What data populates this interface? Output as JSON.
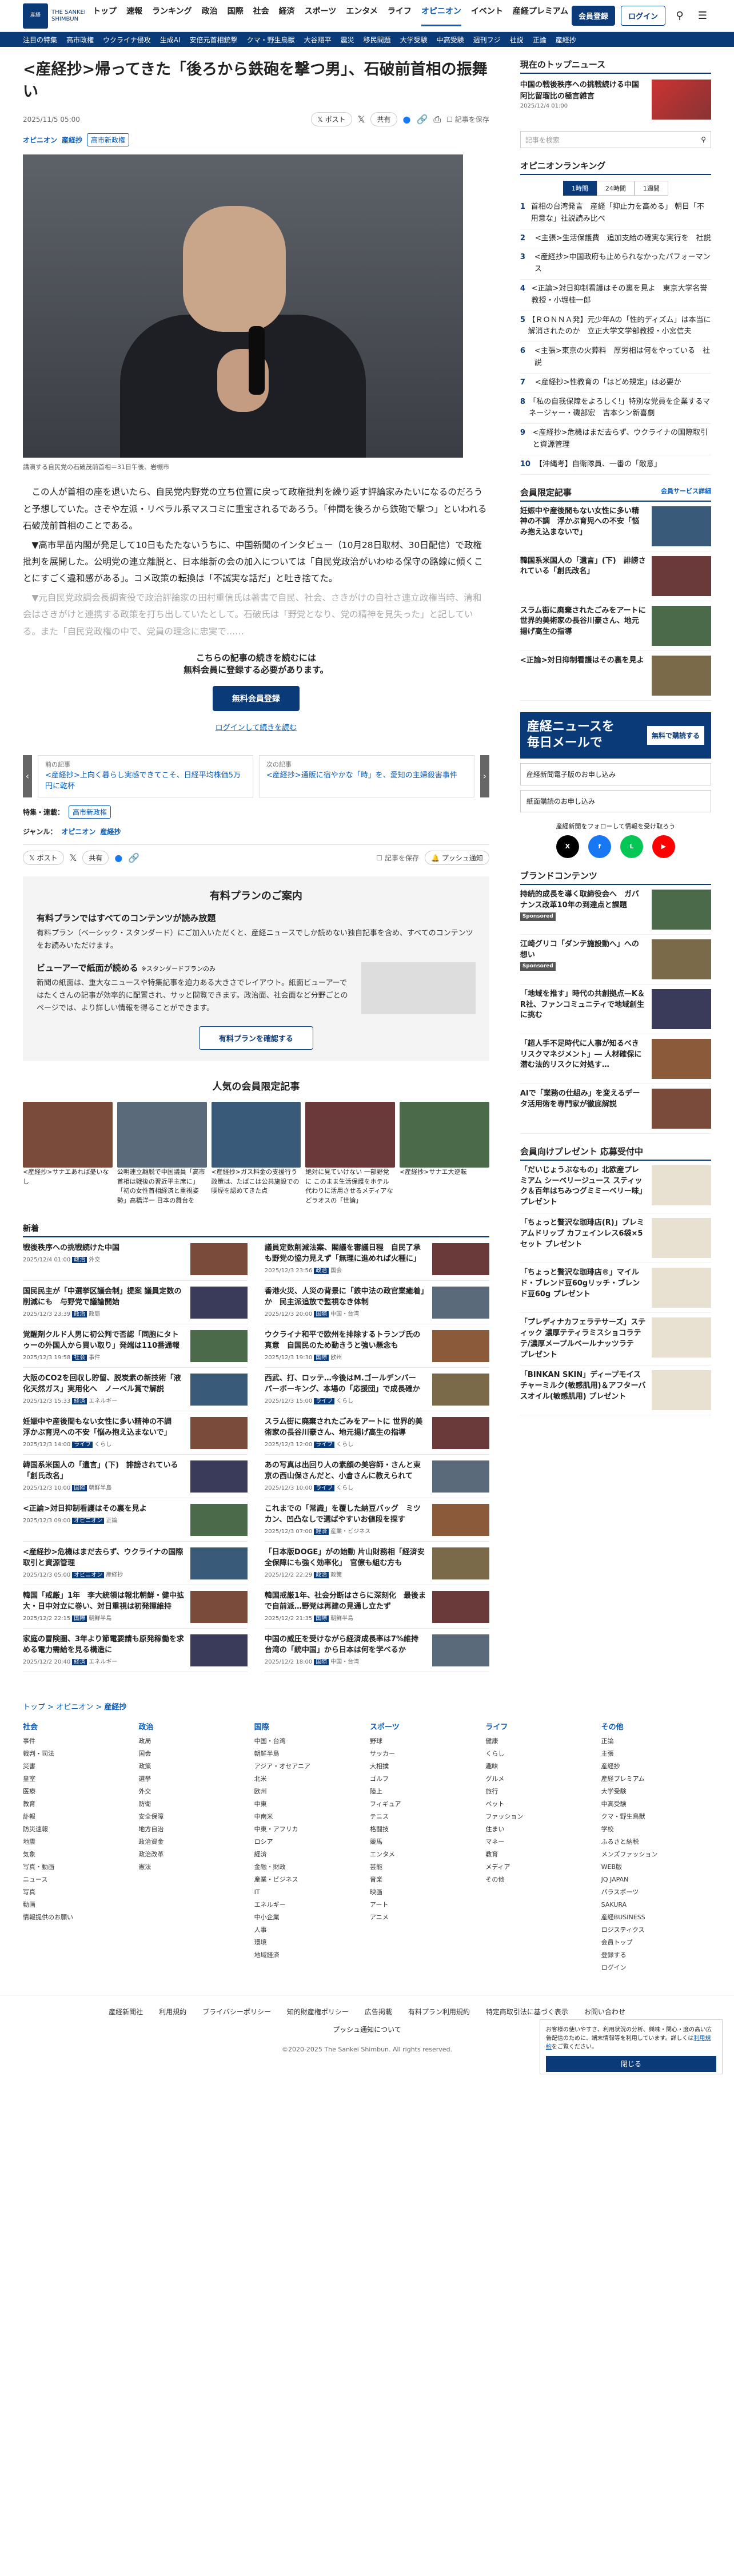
{
  "header": {
    "logo_text": "THE SANKEI SHIMBUN",
    "logo_mark": "産経",
    "nav": [
      "トップ",
      "速報",
      "ランキング",
      "政治",
      "国際",
      "社会",
      "経済",
      "スポーツ",
      "エンタメ",
      "ライフ",
      "オピニオン",
      "イベント",
      "産経プレミアム"
    ],
    "nav_active": "オピニオン",
    "member_button": "会員登録",
    "login_button": "ログイン",
    "search_label": "検索",
    "menu_label": "メニュー"
  },
  "subnav": [
    "注目の特集",
    "高市政権",
    "ウクライナ侵攻",
    "生成AI",
    "安倍元首相銃撃",
    "クマ・野生鳥獣",
    "大谷翔平",
    "震災",
    "移民問題",
    "大学受験",
    "中高受験",
    "週刊フジ",
    "社説",
    "正論",
    "産経抄"
  ],
  "article": {
    "title": "<産経抄>帰ってきた「後ろから鉄砲を撃つ男」、石破前首相の振舞い",
    "date": "2025/11/5 05:00",
    "author": "産経抄",
    "post_label": "ポスト",
    "share_label": "共有",
    "save_label": "記事を保存",
    "section": "オピニオン",
    "subsection": "産経抄",
    "tag": "高市新政権",
    "caption": "講演する自民党の石破茂前首相＝31日午後、岩槻市",
    "p1": "　この人が首相の座を退いたら、自民党内野党の立ち位置に戻って政権批判を繰り返す評論家みたいになるのだろうと予想していた。さぞや左派・リベラル系マスコミに重宝されるであろう。「仲間を後ろから鉄砲で撃つ」といわれる石破茂前首相のことである。",
    "p2": "　▼高市早苗内閣が発足して10日もたたないうちに、中国新聞のインタビュー（10月28日取材、30日配信）で政権批判を展開した。公明党の連立離脱と、日本維新の会の加入については「自民党政治がいわゆる保守の路線に傾くことにすごく違和感がある」。コメ政策の転換は「不誠実な話だ」と吐き捨てた。",
    "p3": "　▼元自民党政調会長調査役で政治評論家の田村重信氏は著書で自民、社会、さきがけの自社さ連立政権当時、清和会はさきがけと連携する政策を打ち出していたとして。石破氏は「野党となり、党の精神を見失った」と記している。また「自民党政権の中で、党員の理念に忠実で……",
    "paywall_text1": "こちらの記事の続きを読むには",
    "paywall_text2": "無料会員に登録する必要があります。",
    "paywall_button": "無料会員登録",
    "paywall_link": "ログインして続きを読む",
    "prev_label": "前の記事",
    "prev_title": "<産経抄>上向く暮らし実感できてこそ、日経平均株価5万円に乾杯",
    "next_label": "次の記事",
    "next_title": "<産経抄>通販に宿やかな「時」を、愛知の主婦殺害事件",
    "feature_label": "特集・連載：",
    "feature_tag": "高市新政権",
    "genre_label": "ジャンル：",
    "genre": "オピニオン",
    "genre2": "産経抄",
    "push_label": "プッシュ通知"
  },
  "plan": {
    "title": "有料プランのご案内",
    "h1": "有料プランではすべてのコンテンツが読み放題",
    "p1": "有料プラン（ベーシック・スタンダード）にご加入いただくと、産経ニュースでしか読めない独自記事を含め、すべてのコンテンツをお読みいただけます。",
    "h2": "ビューアーで紙面が読める",
    "h2note": "※スタンダードプランのみ",
    "p2": "新聞の紙面は、重大なニュースや特集記事を迫力ある大きさでレイアウト。紙面ビューアーではたくさんの記事が効率的に配置され、サッと閲覧できます。政治面、社会面など分野ごとのページでは、より詳しい情報を得ることができます。",
    "button": "有料プランを確認する"
  },
  "ranking_title": "人気の会員限定記事",
  "ranking": [
    "<産経抄>サナエあれば憂いなし",
    "公明連立離脱で中国議員「高市首相は戦後の習近平主席に」「初の女性首相経済と重視姿勢」高橋洋一 日本の舞台を",
    "<産経抄>ガス料金の支援行う政策は、たばこは公共施設での喫煙を認めてきた点",
    "絶対に見ていけない 一部野党に このまま生活保護をホテル代わりに活用させるメディアなどラオスの「世論」",
    "<産経抄>サナエ大逆転"
  ],
  "news_title": "新着",
  "news": [
    {
      "t": "戦後秩序への挑戦続けた中国",
      "d": "2025/12/4 01:00",
      "c": "政治",
      "s": "外交"
    },
    {
      "t": "議員定数削減法案、閣議を審議日程　自民了承も野党の協力見えず「無理に進めれば火種に」",
      "d": "2025/12/3 23:56",
      "c": "政治",
      "s": "国会"
    },
    {
      "t": "国民民主が「中選挙区議会制」提案 議員定数の削減にも　与野党で議論開始",
      "d": "2025/12/3 23:39",
      "c": "政治",
      "s": "政局"
    },
    {
      "t": "香港火災、人災の背景に「鉄中法の政官業癒着」か　民主派追放で監視なき体制",
      "d": "2025/12/3 20:00",
      "c": "国際",
      "s": "中国・台湾"
    },
    {
      "t": "覚醒剤クルド人男に初公判で否認「同胞にタトゥーの外国人から買い取り」発端は110番通報",
      "d": "2025/12/3 19:58",
      "c": "社会",
      "s": "事件"
    },
    {
      "t": "ウクライナ和平で欧州を排除するトランプ氏の真意　自国民のため動きうと強い懸念も",
      "d": "2025/12/3 19:30",
      "c": "国際",
      "s": "欧州"
    },
    {
      "t": "大阪のCO2を回収し貯留、脱炭素の新技術「液化天然ガス」実用化へ　ノーベル賞で解説",
      "d": "2025/12/3 15:33",
      "c": "経済",
      "s": "エネルギー"
    },
    {
      "t": "西武、打、ロッテ…今後はM.ゴールデンバー　パーボーキング、本場の「応援団」で成長確か",
      "d": "2025/12/3 15:00",
      "c": "ライフ",
      "s": "くらし"
    },
    {
      "t": "妊娠中や産後間もない女性に多い精神の不調　浮かぶ育児への不安「悩み抱え込まないで」",
      "d": "2025/12/3 14:00",
      "c": "ライフ",
      "s": "くらし"
    },
    {
      "t": "スラム街に廃棄されたごみをアートに 世界的美術家の長谷川豪さん、地元揚げ高生の指導",
      "d": "2025/12/3 12:00",
      "c": "ライフ",
      "s": "くらし"
    },
    {
      "t": "韓国系米国人の「遺言」(下)　誹謗されている「創氏改名」",
      "d": "2025/12/3 10:00",
      "c": "国際",
      "s": "朝鮮半島"
    },
    {
      "t": "あの写真は出回り人の素顔の美容師・さんと東京の西山保さんだと、小倉さんに教えられて",
      "d": "2025/12/3 10:00",
      "c": "ライフ",
      "s": "くらし"
    },
    {
      "t": "<正論>対日抑制看護はその裏を見よ",
      "d": "2025/12/3 09:00",
      "c": "オピニオン",
      "s": "正論"
    },
    {
      "t": "これまでの「常識」を覆した納豆バッグ　ミツカン、凹凸なしで選ばやすいお値段を探す",
      "d": "2025/12/3 07:00",
      "c": "経済",
      "s": "産業・ビジネス"
    },
    {
      "t": "<産経抄>危機はまだ去らず、ウクライナの国際取引と資源管理",
      "d": "2025/12/3 05:00",
      "c": "オピニオン",
      "s": "産経抄"
    },
    {
      "t": "「日本版DOGE」がの始動 片山財務相「経済安全保障にも強く効率化」　官僚も組む方も",
      "d": "2025/12/2 22:29",
      "c": "政治",
      "s": "政策"
    },
    {
      "t": "韓国「戒厳」1年　李大統領は報北朝鮮・健中拡大・日中対立に巻い、対日重視は初発揮維持",
      "d": "2025/12/2 22:15",
      "c": "国際",
      "s": "朝鮮半島"
    },
    {
      "t": "韓国戒厳1年、社会分断はさらに深刻化　最後まで自前派…野党は再建の見通し立たず",
      "d": "2025/12/2 21:35",
      "c": "国際",
      "s": "朝鮮半島"
    },
    {
      "t": "家庭の冒険圏、3年より節電要請も原発稼働を求める電力需給を見る構造に",
      "d": "2025/12/2 20:40",
      "c": "経済",
      "s": "エネルギー"
    },
    {
      "t": "中国の威圧を受けながら経済成長率は7%維持　台湾の「統中国」から日本は何を学べるか",
      "d": "2025/12/2 18:00",
      "c": "国際",
      "s": "中国・台湾"
    }
  ],
  "breadcrumb": [
    "トップ",
    "オピニオン",
    "産経抄"
  ],
  "footer_cols": [
    {
      "h": "社会",
      "items": [
        "事件",
        "裁判・司法",
        "災害",
        "皇室",
        "医療",
        "教育",
        "訃報",
        "防災速報",
        "地震",
        "気象",
        "写真・動画",
        "ニュース",
        "写真",
        "動画",
        "情報提供のお願い"
      ]
    },
    {
      "h": "政治",
      "items": [
        "政局",
        "国会",
        "政策",
        "選挙",
        "外交",
        "防衛",
        "安全保障",
        "地方自治",
        "政治資金",
        "政治改革",
        "憲法"
      ]
    },
    {
      "h": "国際",
      "items": [
        "中国・台湾",
        "朝鮮半島",
        "アジア・オセアニア",
        "北米",
        "欧州",
        "中東",
        "中南米",
        "中東・アフリカ",
        "ロシア",
        "経済",
        "金融・財政",
        "産業・ビジネス",
        "IT",
        "エネルギー",
        "中小企業",
        "人事",
        "環境",
        "地域経済"
      ]
    },
    {
      "h": "スポーツ",
      "items": [
        "野球",
        "サッカー",
        "大相撲",
        "ゴルフ",
        "陸上",
        "フィギュア",
        "テニス",
        "格闘技",
        "競馬",
        "エンタメ",
        "芸能",
        "音楽",
        "映画",
        "アート",
        "アニメ"
      ]
    },
    {
      "h": "ライフ",
      "items": [
        "健康",
        "くらし",
        "趣味",
        "グルメ",
        "旅行",
        "ペット",
        "ファッション",
        "住まい",
        "マネー",
        "教育",
        "メディア",
        "その他"
      ]
    },
    {
      "h": "その他",
      "items": [
        "正論",
        "主張",
        "産経抄",
        "産経プレミアム",
        "大学受験",
        "中高受験",
        "クマ・野生鳥獣",
        "学校",
        "ふるさと納税",
        "メンズファッション",
        "WEB版",
        "JQ JAPAN",
        "パラスポーツ",
        "SAKURA",
        "産経BUSINESS",
        "ロジスティクス",
        "会員トップ",
        "登録する",
        "ログイン"
      ]
    }
  ],
  "footer_links": [
    "産経新聞社",
    "利用規約",
    "プライバシーポリシー",
    "知的財産権ポリシー",
    "広告掲載",
    "有料プラン利用規約",
    "特定商取引法に基づく表示",
    "お問い合わせ"
  ],
  "footer_push": "プッシュ通知について",
  "copyright": "©2020-2025 The Sankei Shimbun. All rights reserved.",
  "sidebar": {
    "top_title": "現在のトップニュース",
    "top_item": "中国の戦後秩序への挑戦続ける中国　阿比留瑠比の極言雑言",
    "top_date": "2025/12/4 01:00",
    "search_placeholder": "記事を検索",
    "ranking_title": "オピニオンランキング",
    "tabs": [
      "1時間",
      "24時間",
      "1週間"
    ],
    "ranking": [
      "首相の台湾発言　産経「抑止力を高める」 朝日「不用意な」社説読み比べ",
      "<主張>生活保護費　追加支給の確実な実行を　社説",
      "<産経抄>中国政府も止められなかったパフォーマンス",
      "<正論>対日抑制看護はその裏を見よ　東京大学名誉教授・小堀桂一郎",
      "【ＲＯＮＮＡ発】元少年Aの「性的ディズム」は本当に解消されたのか　立正大学文学部教授・小宮信夫",
      "<主張>東京の火葬料　厚労相は何をやっている　社説",
      "<産経抄>性教育の「はどめ規定」は必要か",
      "「私の自我保障をよろしく!」特別な党員を企業するマネージャー・磯部宏　吉本シン新喜劇",
      "<産経抄>危機はまだ去らず、ウクライナの国際取引と資源管理",
      "【沖縄考】自衛隊員、一番の「敵意」"
    ],
    "member_title": "会員限定記事",
    "member_link": "会員サービス詳細",
    "member": [
      "妊娠中や産後間もない女性に多い精神の不調　浮かぶ育児への不安「悩み抱え込まないで」",
      "韓国系米国人の「遺言」(下)　誹謗されている「創氏改名」",
      "スラム街に廃棄されたごみをアートに 世界的美術家の長谷川豪さん、地元揚げ高生の指導",
      "<正論>対日抑制看護はその裏を見よ"
    ],
    "mail_line1": "産経ニュースを",
    "mail_line2": "毎日メールで",
    "mail_button": "無料で購読する",
    "links": [
      "産経新聞電子版のお申し込み",
      "紙面購読のお申し込み"
    ],
    "sns_label": "産経新聞をフォローして情報を受け取ろう",
    "sns": [
      "X",
      "f",
      "L",
      "▶"
    ],
    "brand_title": "ブランドコンテンツ",
    "brand": [
      "持続的成長を導く取締役会へ　ガバナンス改革10年の到達点と課題",
      "江崎グリコ「ダンテ施設動へ」への想い",
      "「地域を推す」時代の共創拠点—K＆R社、ファンコミュニティで地域創生に挑む",
      "「超人手不足時代に人事が知るべきリスクマネジメント」― 人材確保に潜む法的リスクに対処す…",
      "AIで「業務の仕組み」を変えるデータ活用術を専門家が徹底解説"
    ],
    "sponsored": "Sponsored",
    "present_title": "会員向けプレゼント 応募受付中",
    "present": [
      "「だいじょうぶなもの」北欧産プレミアム シーベリージュース スティック＆百年はちみつグミミーベリー味」プレゼント",
      "「ちょっと贅沢な珈琲店(R)」プレミアムドリップ カフェインレス6袋×5セット プレゼント",
      "「ちょっと贅沢な珈琲店®」マイルド・ブレンド豆60gリッチ・ブレンド豆60g プレゼント",
      "「プレディナカフェラテサーズ」スティック 濃厚テティラミスショコラテテ/濃厚メープルベールナッツラテ　プレゼント",
      "「BINKAN SKIN」ディープモイスチャーミルク(敏感肌用)＆アフターバスオイル(敏感肌用) プレゼント"
    ]
  },
  "notice": {
    "text": "お客様の使いやすさ、利用状況の分析、興味・関心・度の高い広告配信のために、端末情報等を利用しています。詳しくは",
    "link": "利用規約",
    "text2": "をご覧ください。",
    "button": "閉じる"
  },
  "colors": {
    "brand": "#0a3a78",
    "link": "#0a5bb5"
  }
}
